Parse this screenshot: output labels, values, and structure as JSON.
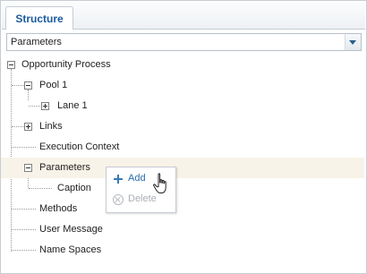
{
  "tabs": [
    {
      "label": "Structure"
    }
  ],
  "dropdown": {
    "value": "Parameters"
  },
  "tree": {
    "root": "Opportunity Process",
    "pool": "Pool 1",
    "lane": "Lane 1",
    "links": "Links",
    "execution_context": "Execution Context",
    "parameters": "Parameters",
    "caption": "Caption",
    "methods": "Methods",
    "user_message": "User Message",
    "name_spaces": "Name Spaces"
  },
  "context_menu": {
    "add": "Add",
    "delete": "Delete"
  },
  "colors": {
    "tab_text": "#1a5a9e",
    "selected_row": "#f8f3e8",
    "menu_enabled": "#2a6cb0",
    "menu_disabled": "#a9aeb4"
  },
  "icons": [
    "chevron-down-icon",
    "collapse-icon",
    "expand-icon",
    "add-icon",
    "delete-icon",
    "hand-cursor-icon"
  ]
}
